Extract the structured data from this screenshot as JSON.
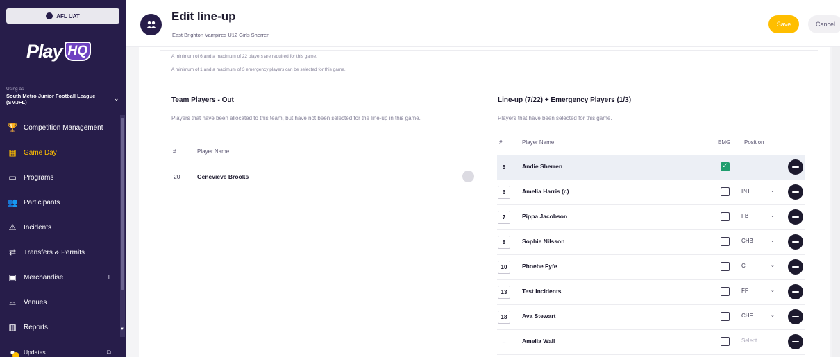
{
  "sidebar": {
    "env_label": "AFL UAT",
    "logo": {
      "play": "Play",
      "hq": "HQ"
    },
    "using_as_label": "Using as",
    "organisation": "South Metro Junior Football League (SMJFL)",
    "items": [
      {
        "label": "Competition Management",
        "icon": "trophy-icon",
        "glyph": "🏆",
        "active": false
      },
      {
        "label": "Game Day",
        "icon": "scoreboard-icon",
        "glyph": "▦",
        "active": true
      },
      {
        "label": "Programs",
        "icon": "book-icon",
        "glyph": "▭",
        "active": false
      },
      {
        "label": "Participants",
        "icon": "people-icon",
        "glyph": "👥",
        "active": false
      },
      {
        "label": "Incidents",
        "icon": "warning-icon",
        "glyph": "⚠",
        "active": false
      },
      {
        "label": "Transfers & Permits",
        "icon": "transfer-icon",
        "glyph": "⇄",
        "active": false
      },
      {
        "label": "Merchandise",
        "icon": "box-icon",
        "glyph": "▣",
        "active": false
      },
      {
        "label": "Venues",
        "icon": "stadium-icon",
        "glyph": "⌓",
        "active": false
      },
      {
        "label": "Reports",
        "icon": "report-icon",
        "glyph": "▥",
        "active": false
      },
      {
        "label": "Updates",
        "icon": "bell-icon",
        "glyph": "●",
        "active": false
      }
    ],
    "merch_plus": "+",
    "updates_ext": "⧉"
  },
  "header": {
    "title": "Edit line-up",
    "subtitle": "East Brighton Vampires U12 Girls Sherren",
    "save_label": "Save",
    "cancel_label": "Cancel"
  },
  "notices": [
    "A minimum of 6 and a maximum of 22 players are required for this game.",
    "A minimum of 1 and a maximum of 3 emergency players can be selected for this game."
  ],
  "team_out": {
    "title": "Team Players - Out",
    "description": "Players that have been allocated to this team, but have not been selected for the line-up in this game.",
    "col_number": "#",
    "col_name": "Player Name",
    "players": [
      {
        "number": "20",
        "name": "Genevieve Brooks"
      }
    ]
  },
  "lineup": {
    "title": "Line-up (7/22) + Emergency Players (1/3)",
    "description": "Players that have been selected for this game.",
    "col_number": "#",
    "col_name": "Player Name",
    "col_emg": "EMG",
    "col_position": "Position",
    "players": [
      {
        "number": "5",
        "name": "Andie Sherren",
        "emg": true,
        "position": ""
      },
      {
        "number": "6",
        "name": "Amelia Harris (c)",
        "emg": false,
        "position": "INT"
      },
      {
        "number": "7",
        "name": "Pippa Jacobson",
        "emg": false,
        "position": "FB"
      },
      {
        "number": "8",
        "name": "Sophie Nilsson",
        "emg": false,
        "position": "CHB"
      },
      {
        "number": "10",
        "name": "Phoebe Fyfe",
        "emg": false,
        "position": "C"
      },
      {
        "number": "13",
        "name": "Test Incidents",
        "emg": false,
        "position": "FF"
      },
      {
        "number": "18",
        "name": "Ava Stewart",
        "emg": false,
        "position": "CHF"
      },
      {
        "number": "–",
        "name": "Amelia Wall",
        "emg": false,
        "position": "Select"
      }
    ]
  }
}
